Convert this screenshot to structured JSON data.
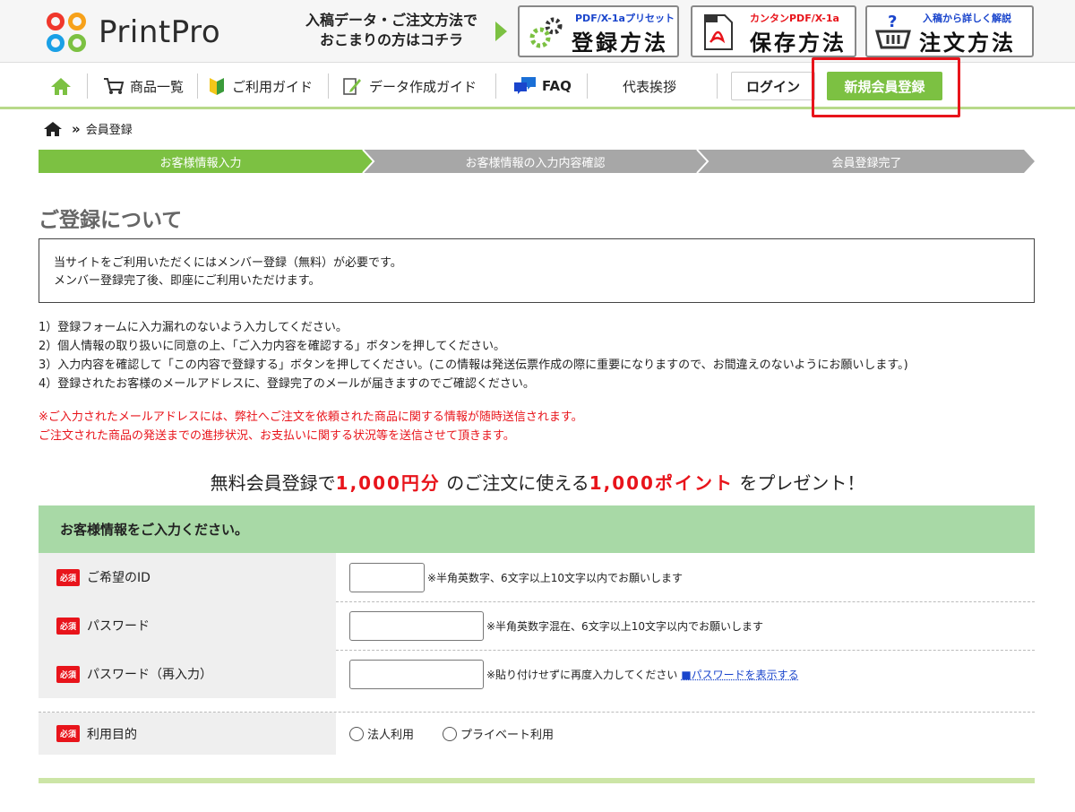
{
  "header": {
    "logo_text": "PrintPro",
    "promo_line1": "入稿データ・ご注文方法で",
    "promo_line2": "おこまりの方はコチラ",
    "buttons": [
      {
        "sub": "PDF/X-1aプリセット",
        "main": "登録方法",
        "sub_color": "#1a45cc"
      },
      {
        "sub": "カンタンPDF/X-1a",
        "main": "保存方法",
        "sub_color": "#e8141b"
      },
      {
        "sub": "入稿から詳しく解説",
        "main": "注文方法",
        "sub_color": "#1a45cc"
      }
    ],
    "pdf_icon_top": "PDF",
    "pdf_icon_bottom": "X-1a"
  },
  "nav": {
    "products": "商品一覧",
    "guide": "ご利用ガイド",
    "data_guide": "データ作成ガイド",
    "faq": "FAQ",
    "greeting": "代表挨拶",
    "login": "ログイン",
    "register": "新規会員登録"
  },
  "breadcrumb": {
    "sep": "»",
    "current": "会員登録"
  },
  "steps": [
    "お客様情報入力",
    "お客様情報の入力内容確認",
    "会員登録完了"
  ],
  "section_title": "ご登録について",
  "notice": {
    "line1": "当サイトをご利用いただくにはメンバー登録（無料）が必要です。",
    "line2": "メンバー登録完了後、即座にご利用いただけます。"
  },
  "instructions": [
    "1）登録フォームに入力漏れのないよう入力してください。",
    "2）個人情報の取り扱いに同意の上、「ご入力内容を確認する」ボタンを押してください。",
    "3）入力内容を確認して「この内容で登録する」ボタンを押してください。(この情報は発送伝票作成の際に重要になりますので、お間違えのないようにお願いします。)",
    "4）登録されたお客様のメールアドレスに、登録完了のメールが届きますのでご確認ください。"
  ],
  "warning": {
    "line1": "※ご入力されたメールアドレスには、弊社へご注文を依頼された商品に関する情報が随時送信されます。",
    "line2": "ご注文された商品の発送までの進捗状況、お支払いに関する状況等を送信させて頂きます。"
  },
  "promo": {
    "part1": "無料会員登録で",
    "amount": "1,000円分",
    "part2": "のご注文に使える",
    "points": "1,000ポイント",
    "part3": "をプレゼント！"
  },
  "form": {
    "heading": "お客様情報をご入力ください。",
    "required_badge": "必須",
    "rows": [
      {
        "label": "ご希望のID",
        "hint": "※半角英数字、6文字以上10文字以内でお願いします"
      },
      {
        "label": "パスワード",
        "hint": "※半角英数字混在、6文字以上10文字以内でお願いします"
      },
      {
        "label": "パスワード（再入力）",
        "hint": "※貼り付けせずに再度入力してください",
        "link": "■パスワードを表示する"
      },
      {
        "label": "利用目的",
        "options": [
          "法人利用",
          "プライベート利用"
        ]
      }
    ]
  },
  "colors": {
    "brand_green": "#7cc142",
    "alert_red": "#e8141b",
    "form_header": "#a8d9a6"
  }
}
